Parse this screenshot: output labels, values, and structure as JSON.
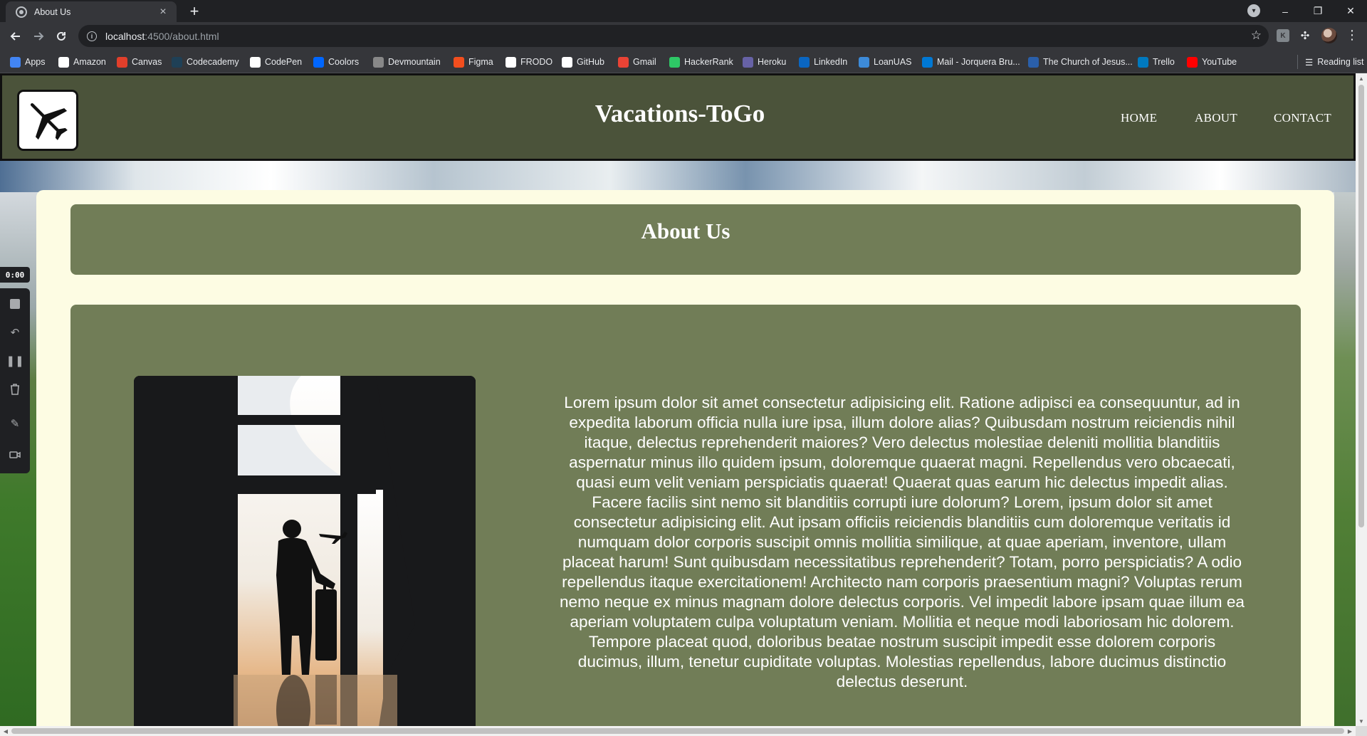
{
  "browser": {
    "tab_title": "About Us",
    "tab_close": "×",
    "new_tab": "+",
    "url_host": "localhost",
    "url_path": ":4500/about.html",
    "window_controls": {
      "minimize": "–",
      "restore": "❐",
      "close": "✕"
    },
    "bookmarks": [
      {
        "label": "Apps",
        "icon": "apps-grid-icon",
        "color": "#4285f4"
      },
      {
        "label": "Amazon",
        "icon": "amazon-icon",
        "color": "#ffffff"
      },
      {
        "label": "Canvas",
        "icon": "canvas-icon",
        "color": "#e13f2b"
      },
      {
        "label": "Codecademy",
        "icon": "codecademy-icon",
        "color": "#1f4056"
      },
      {
        "label": "CodePen",
        "icon": "codepen-icon",
        "color": "#ffffff"
      },
      {
        "label": "Coolors",
        "icon": "coolors-icon",
        "color": "#0066ff"
      },
      {
        "label": "Devmountain",
        "icon": "devmountain-icon",
        "color": "#888888"
      },
      {
        "label": "Figma",
        "icon": "figma-icon",
        "color": "#f24e1e"
      },
      {
        "label": "FRODO",
        "icon": "frodo-icon",
        "color": "#ffffff"
      },
      {
        "label": "GitHub",
        "icon": "github-icon",
        "color": "#ffffff"
      },
      {
        "label": "Gmail",
        "icon": "gmail-icon",
        "color": "#ea4335"
      },
      {
        "label": "HackerRank",
        "icon": "hackerrank-icon",
        "color": "#2ec866"
      },
      {
        "label": "Heroku",
        "icon": "heroku-icon",
        "color": "#6762a6"
      },
      {
        "label": "LinkedIn",
        "icon": "linkedin-icon",
        "color": "#0a66c2"
      },
      {
        "label": "LoanUAS",
        "icon": "loanuas-icon",
        "color": "#3d8bd9"
      },
      {
        "label": "Mail - Jorquera Bru...",
        "icon": "outlook-icon",
        "color": "#0078d4"
      },
      {
        "label": "The Church of Jesus...",
        "icon": "church-icon",
        "color": "#2a5faa"
      },
      {
        "label": "Trello",
        "icon": "trello-icon",
        "color": "#0079bf"
      },
      {
        "label": "YouTube",
        "icon": "youtube-icon",
        "color": "#ff0000"
      }
    ],
    "reading_list": "Reading list"
  },
  "site": {
    "title": "Vacations-ToGo",
    "nav": [
      "HOME",
      "ABOUT",
      "CONTACT"
    ],
    "header_color": "#4b533a",
    "panel_color": "#717d57",
    "card_color": "#fdfce3"
  },
  "about": {
    "heading": "About Us",
    "body": "Lorem ipsum dolor sit amet consectetur adipisicing elit. Ratione adipisci ea consequuntur, ad in expedita laborum officia nulla iure ipsa, illum dolore alias? Quibusdam nostrum reiciendis nihil itaque, delectus reprehenderit maiores? Vero delectus molestiae deleniti mollitia blanditiis aspernatur minus illo quidem ipsum, doloremque quaerat magni. Repellendus vero obcaecati, quasi eum velit veniam perspiciatis quaerat! Quaerat quas earum hic delectus impedit alias. Facere facilis sint nemo sit blanditiis corrupti iure dolorum? Lorem, ipsum dolor sit amet consectetur adipisicing elit. Aut ipsam officiis reiciendis blanditiis cum doloremque veritatis id numquam dolor corporis suscipit omnis mollitia similique, at quae aperiam, inventore, ullam placeat harum! Sunt quibusdam necessitatibus reprehenderit? Totam, porro perspiciatis? A odio repellendus itaque exercitationem! Architecto nam corporis praesentium magni? Voluptas rerum nemo neque ex minus magnam dolore delectus corporis. Vel impedit labore ipsam quae illum ea aperiam voluptatem culpa voluptatum veniam. Mollitia et neque modi laboriosam hic dolorem. Tempore placeat quod, doloribus beatae nostrum suscipit impedit esse dolorem corporis ducimus, illum, tenetur cupiditate voluptas. Molestias repellendus, labore ducimus distinctio delectus deserunt."
  },
  "recorder": {
    "timer": "0:00"
  }
}
